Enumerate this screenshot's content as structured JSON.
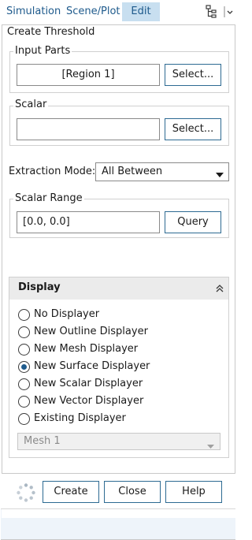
{
  "tabs": {
    "simulation": "Simulation",
    "scene_plot": "Scene/Plot",
    "edit": "Edit"
  },
  "panel": {
    "title": "Create Threshold",
    "input_parts": {
      "label": "Input Parts",
      "value": "[Region 1]",
      "select_label": "Select..."
    },
    "scalar": {
      "label": "Scalar",
      "value": "",
      "select_label": "Select..."
    },
    "extraction_mode": {
      "label": "Extraction Mode:",
      "selected": "All Between"
    },
    "scalar_range": {
      "label": "Scalar Range",
      "value": "[0.0, 0.0]",
      "query_label": "Query"
    }
  },
  "display": {
    "title": "Display",
    "options": [
      {
        "label": "No Displayer",
        "checked": false
      },
      {
        "label": "New Outline Displayer",
        "checked": false
      },
      {
        "label": "New Mesh Displayer",
        "checked": false
      },
      {
        "label": "New Surface Displayer",
        "checked": true
      },
      {
        "label": "New Scalar Displayer",
        "checked": false
      },
      {
        "label": "New Vector Displayer",
        "checked": false
      },
      {
        "label": "Existing Displayer",
        "checked": false
      }
    ],
    "existing_select": "Mesh 1"
  },
  "buttons": {
    "create": "Create",
    "close": "Close",
    "help": "Help"
  },
  "colors": {
    "accent": "#1e5a8c",
    "active_tab": "#c8dff0",
    "button_border": "#2d6a92",
    "header_bg": "#ebebeb"
  },
  "icons": {
    "tree": "tree-view-icon",
    "menu": "chevron-down-icon",
    "collapse": "double-chevron-up-icon",
    "spinner": "loading-spinner-icon"
  }
}
